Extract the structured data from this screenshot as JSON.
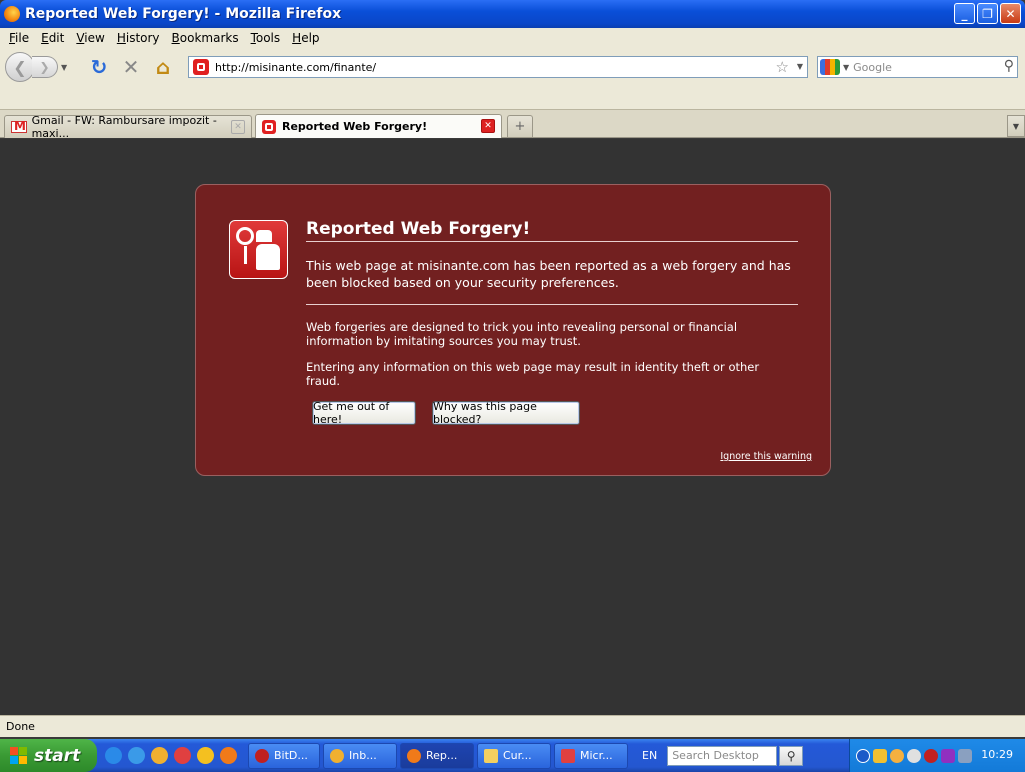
{
  "window": {
    "title": "Reported Web Forgery! - Mozilla Firefox",
    "buttons": {
      "minimize": "_",
      "maximize": "❐",
      "close": "✕"
    }
  },
  "menu": {
    "items": [
      "File",
      "Edit",
      "View",
      "History",
      "Bookmarks",
      "Tools",
      "Help"
    ]
  },
  "nav": {
    "url": "http://misinante.com/finante/",
    "search_placeholder": "Google"
  },
  "tabs": [
    {
      "label": "Gmail - FW: Rambursare impozit - maxi...",
      "active": false
    },
    {
      "label": "Reported Web Forgery!",
      "active": true
    }
  ],
  "error_page": {
    "title": "Reported Web Forgery!",
    "short_desc": "This web page at misinante.com has been reported as a web forgery and has been blocked based on your security preferences.",
    "long_desc_1": "Web forgeries are designed to trick you into revealing personal or financial information by imitating sources you may trust.",
    "long_desc_2": "Entering any information on this web page may result in identity theft or other fraud.",
    "get_out_button": "Get me out of here!",
    "why_blocked_button": "Why was this page blocked?",
    "ignore_link": "Ignore this warning",
    "bg_color": "#722020"
  },
  "status": {
    "text": "Done"
  },
  "taskbar": {
    "start_label": "start",
    "tasks": [
      {
        "label": "BitD...",
        "active": false
      },
      {
        "label": "Inb...",
        "active": false
      },
      {
        "label": "Rep...",
        "active": true
      },
      {
        "label": "Cur...",
        "active": false
      },
      {
        "label": "Micr...",
        "active": false
      }
    ],
    "language": "EN",
    "desktop_search_placeholder": "Search Desktop",
    "clock": "10:29"
  }
}
